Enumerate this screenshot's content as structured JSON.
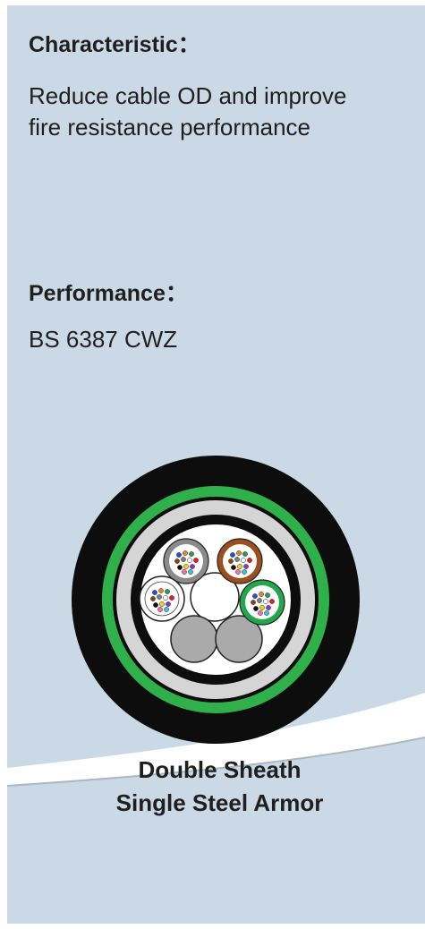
{
  "characteristic": {
    "heading": "Characteristic：",
    "text": "Reduce cable OD and improve fire resistance performance"
  },
  "performance": {
    "heading": "Performance：",
    "text": "BS 6387 CWZ"
  },
  "product": {
    "line1": "Double Sheath",
    "line2": "Single Steel Armor"
  },
  "colors": {
    "background": "#cbd9e6",
    "outer_sheath": "#0d0d0d",
    "green_ring": "#2fb04a",
    "armor_ring": "#c8c8c8",
    "tube_grey": "#8a8a8a",
    "tube_brown": "#9b4f1c",
    "tube_green": "#22a84a",
    "filler_grey": "#aaaaaa"
  }
}
